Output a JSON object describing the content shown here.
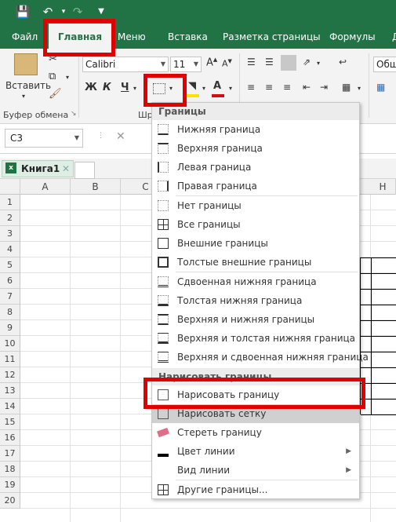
{
  "tabs": [
    "Файл",
    "Главная",
    "Меню",
    "Вставка",
    "Разметка страницы",
    "Формулы",
    "Д"
  ],
  "clipboard": {
    "paste_label": "Вставить",
    "group_label": "Буфер обмена"
  },
  "font": {
    "family": "Calibri",
    "size": "11",
    "bold": "Ж",
    "italic": "К",
    "underline": "Ч",
    "color_letter": "А",
    "group_label_partial": "Шр"
  },
  "styles": {
    "partial_label": "Общ"
  },
  "name_box": "C3",
  "formula_cancel": "✕",
  "workbook": {
    "tab_label": "Книга1",
    "close": "✕"
  },
  "columns": [
    "A",
    "B",
    "C",
    "H"
  ],
  "rows": [
    "1",
    "2",
    "3",
    "4",
    "5",
    "6",
    "7",
    "8",
    "9",
    "10",
    "11",
    "12",
    "13",
    "14",
    "15",
    "16",
    "17",
    "18",
    "19",
    "20"
  ],
  "menu": {
    "header_borders": "Границы",
    "items_a": [
      "Нижняя граница",
      "Верхняя граница",
      "Левая граница",
      "Правая граница"
    ],
    "items_b": [
      "Нет границы",
      "Все границы",
      "Внешние границы",
      "Толстые внешние границы"
    ],
    "items_c": [
      "Сдвоенная нижняя граница",
      "Толстая нижняя граница",
      "Верхняя и нижняя границы",
      "Верхняя и толстая нижняя граница",
      "Верхняя и сдвоенная нижняя граница"
    ],
    "header_draw": "Нарисовать границы",
    "items_d": [
      "Нарисовать границу",
      "Нарисовать сетку",
      "Стереть границу",
      "Цвет линии",
      "Вид линии"
    ],
    "more": "Другие границы..."
  },
  "colors": {
    "excel_green": "#217346",
    "highlight_red": "#e00000",
    "font_color_red": "#d01010",
    "fill_yellow": "#ffe000"
  }
}
